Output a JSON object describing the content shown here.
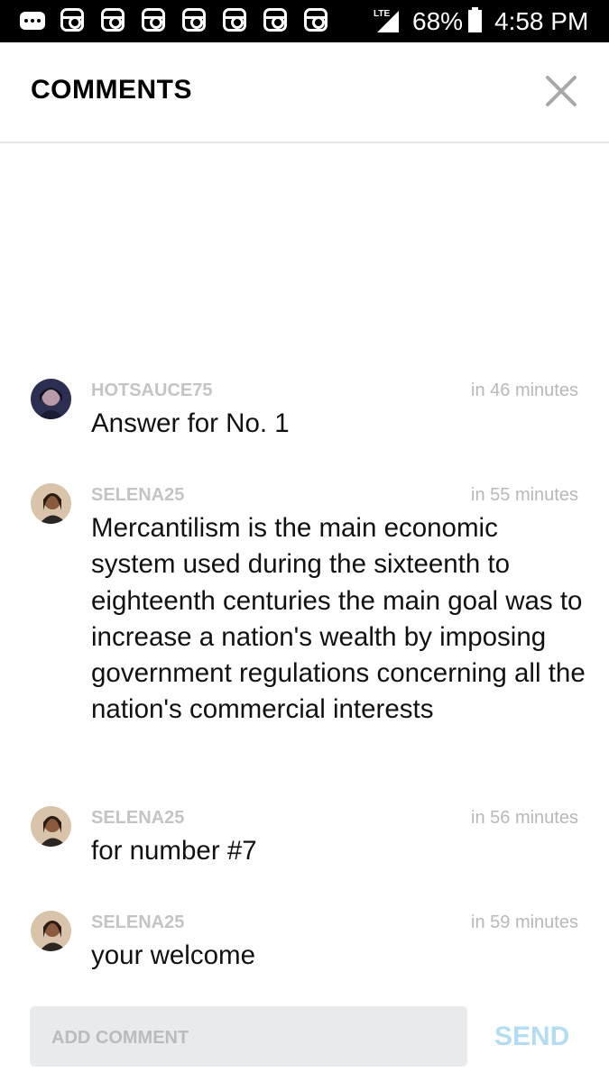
{
  "status_bar": {
    "battery": "68%",
    "time": "4:58 PM",
    "network": "LTE",
    "notification_icons": [
      "messages-icon",
      "instagram-icon",
      "instagram-icon",
      "instagram-icon",
      "instagram-icon",
      "instagram-icon",
      "instagram-icon",
      "instagram-icon"
    ]
  },
  "header": {
    "title": "COMMENTS",
    "close_icon": "close-icon"
  },
  "comments": [
    {
      "username": "HOTSAUCE75",
      "time": "in 46 minutes",
      "text": "Answer for No. 1"
    },
    {
      "username": "SELENA25",
      "time": "in 55 minutes",
      "text": "Mercantilism is the main economic system used during the sixteenth to eighteenth centuries the main goal was to increase a nation's wealth by imposing government regulations concerning all the nation's commercial interests"
    },
    {
      "username": "SELENA25",
      "time": "in 56 minutes",
      "text": "for number #7"
    },
    {
      "username": "SELENA25",
      "time": "in 59 minutes",
      "text": "your welcome"
    }
  ],
  "footer": {
    "placeholder": "ADD COMMENT",
    "send_label": "SEND"
  },
  "colors": {
    "username": "#c4c4c4",
    "time": "#b8b8b8",
    "send": "#b4dcf2",
    "input_bg": "#e8eaec"
  }
}
